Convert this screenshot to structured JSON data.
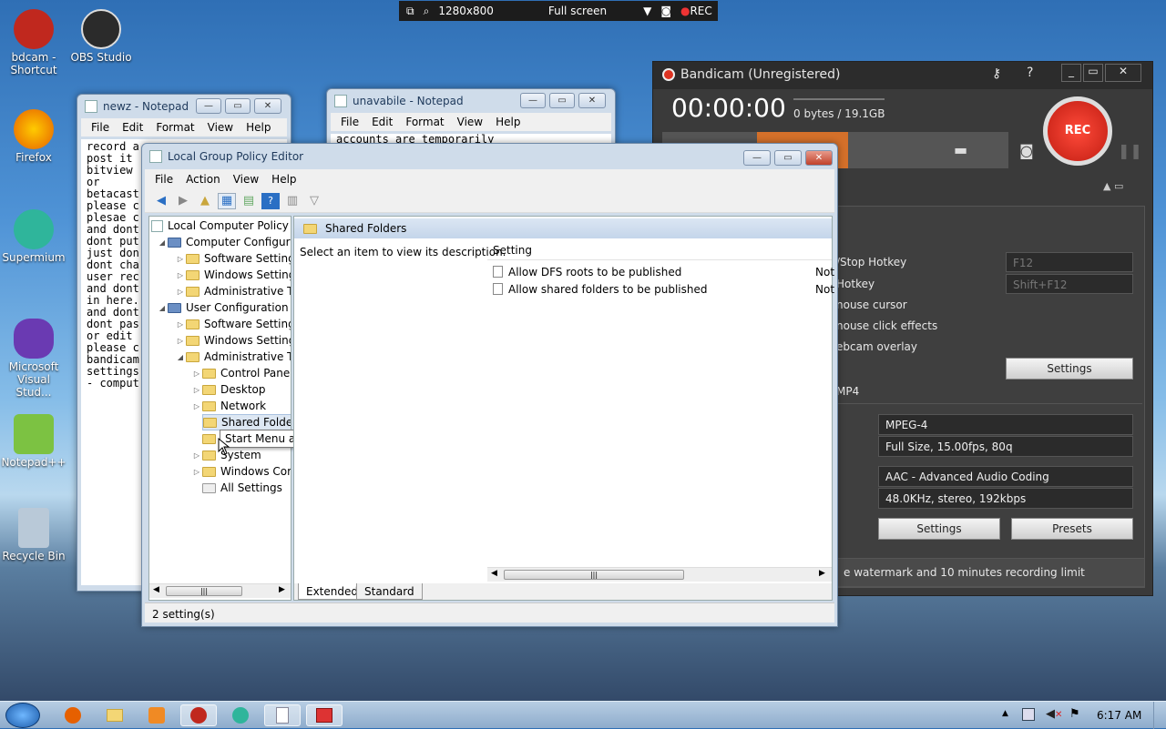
{
  "capture_bar": {
    "resolution": "1280x800",
    "mode": "Full screen",
    "rec": "REC"
  },
  "desktop_icons": [
    {
      "name": "bdcam - Shortcut",
      "color": "#c0281e"
    },
    {
      "name": "OBS Studio",
      "color": "#2b2b2b"
    },
    {
      "name": "Firefox",
      "color": "#e66000"
    },
    {
      "name": "Supermium",
      "color": "#2fb59b"
    },
    {
      "name": "Microsoft Visual Stud...",
      "color": "#6a3ab2"
    },
    {
      "name": "Notepad++",
      "color": "#7cc242"
    },
    {
      "name": "Recycle Bin",
      "color": "#b9c9d8"
    }
  ],
  "notepad1": {
    "title": "newz - Notepad",
    "menu": [
      "File",
      "Edit",
      "Format",
      "View",
      "Help"
    ],
    "text": "record a\npost it\nbitview\nor\nbetacast\nplease c\nplesae c\nand dont\ndont put\njust don\ndont cha\nuser rec\nand dont\nin here.\nand dont\ndont pas\nor edit\nplease c\nbandicam\nsettings\n- comput"
  },
  "notepad2": {
    "title": "unavabile - Notepad",
    "menu": [
      "File",
      "Edit",
      "Format",
      "View",
      "Help"
    ],
    "text": "accounts are temporarily"
  },
  "gpe": {
    "title": "Local Group Policy Editor",
    "menu": [
      "File",
      "Action",
      "View",
      "Help"
    ],
    "tree": {
      "root": "Local Computer Policy",
      "computer_config": "Computer Configura",
      "cc_software": "Software Settings",
      "cc_windows": "Windows Setting",
      "cc_admin": "Administrative Te",
      "user_config": "User Configuration",
      "uc_software": "Software Settings",
      "uc_windows": "Windows Setting",
      "uc_admin": "Administrative Te",
      "control_panel": "Control Panel",
      "desktop": "Desktop",
      "network": "Network",
      "shared_folders": "Shared Folder",
      "start_menu": "Start Menu and Taskbar",
      "system": "System",
      "windows_comp": "Windows Cor",
      "all_settings": "All Settings"
    },
    "tooltip": "Start Menu and Taskbar",
    "header": "Shared Folders",
    "description": "Select an item to view its description.",
    "column_setting": "Setting",
    "rows": [
      {
        "name": "Allow DFS roots to be published",
        "state": "Not"
      },
      {
        "name": "Allow shared folders to be published",
        "state": "Not"
      }
    ],
    "tabs": [
      "Extended",
      "Standard"
    ],
    "status": "2 setting(s)"
  },
  "bandicam": {
    "title": "Bandicam (Unregistered)",
    "timer": "00:00:00",
    "size": "0 bytes / 19.1GB",
    "rec": "REC",
    "hotkey1_label": "/Stop Hotkey",
    "hotkey1_value": "F12",
    "hotkey2_label": "Hotkey",
    "hotkey2_value": "Shift+F12",
    "mouse_cursor": "nouse cursor",
    "mouse_click": "nouse click effects",
    "webcam": "ebcam overlay",
    "settings1": "Settings",
    "format": "MP4",
    "video_codec": "MPEG-4",
    "video_spec": "Full Size, 15.00fps, 80q",
    "audio_codec": "AAC - Advanced Audio Coding",
    "audio_spec": "48.0KHz, stereo, 192kbps",
    "settings2": "Settings",
    "presets": "Presets",
    "footer": "e watermark and 10 minutes recording limit"
  },
  "taskbar": {
    "clock": "6:17 AM"
  }
}
